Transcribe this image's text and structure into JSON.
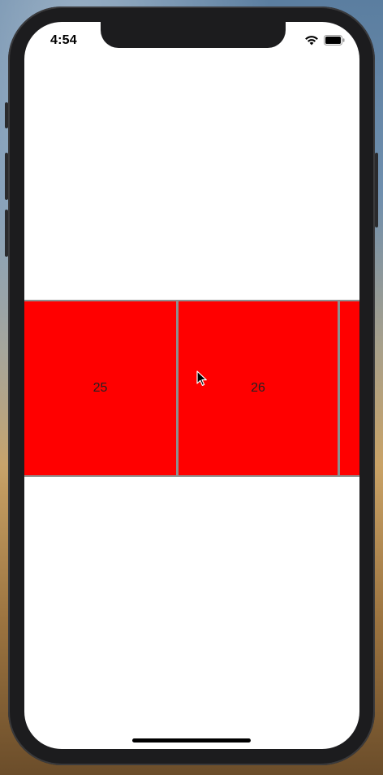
{
  "status_bar": {
    "time": "4:54",
    "icons": [
      "wifi-icon",
      "battery-icon"
    ]
  },
  "carousel": {
    "pages": [
      {
        "label": ""
      },
      {
        "label": "25"
      },
      {
        "label": "26"
      },
      {
        "label": ""
      }
    ],
    "page_color": "#ff0000",
    "divider_color": "#8e8e8e"
  },
  "colors": {
    "screen_background": "#ffffff",
    "device_frame": "#1c1c1e"
  }
}
